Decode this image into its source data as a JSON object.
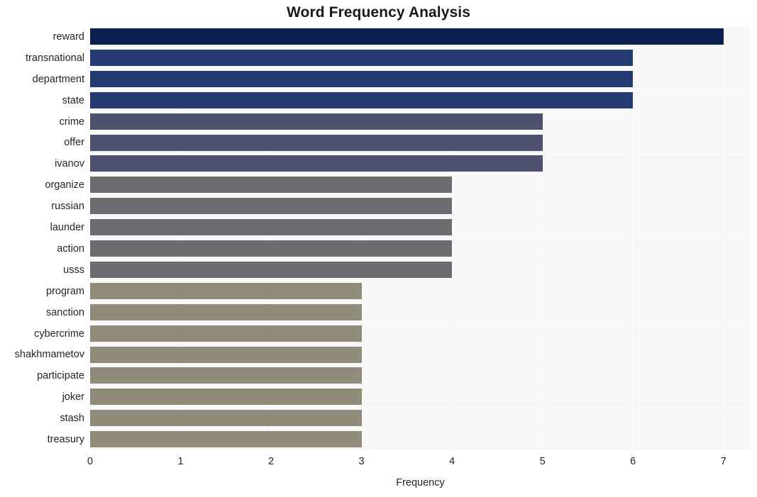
{
  "chart_data": {
    "type": "bar",
    "orientation": "horizontal",
    "title": "Word Frequency Analysis",
    "xlabel": "Frequency",
    "ylabel": "",
    "xlim": [
      0,
      7.3
    ],
    "xticks": [
      "0",
      "1",
      "2",
      "3",
      "4",
      "5",
      "6",
      "7"
    ],
    "xtick_values": [
      0,
      1,
      2,
      3,
      4,
      5,
      6,
      7
    ],
    "grid": true,
    "legend": null,
    "categories": [
      "reward",
      "transnational",
      "department",
      "state",
      "crime",
      "offer",
      "ivanov",
      "organize",
      "russian",
      "launder",
      "action",
      "usss",
      "program",
      "sanction",
      "cybercrime",
      "shakhmametov",
      "participate",
      "joker",
      "stash",
      "treasury"
    ],
    "values": [
      7,
      6,
      6,
      6,
      5,
      5,
      5,
      4,
      4,
      4,
      4,
      4,
      3,
      3,
      3,
      3,
      3,
      3,
      3,
      3
    ],
    "bar_colors": [
      "#0a2150",
      "#243c72",
      "#243c72",
      "#243c72",
      "#4e5270",
      "#4e5270",
      "#4e5270",
      "#6b6d70",
      "#6b6d70",
      "#6b6d70",
      "#6b6d70",
      "#6b6d70",
      "#918b79",
      "#918b79",
      "#918b79",
      "#918b79",
      "#918b79",
      "#918b79",
      "#918b79",
      "#918b79"
    ],
    "plot_background": "#f7f7f7",
    "figure_background": "#ffffff",
    "gridline_color": "#ffffff",
    "text_color": "#262626"
  }
}
